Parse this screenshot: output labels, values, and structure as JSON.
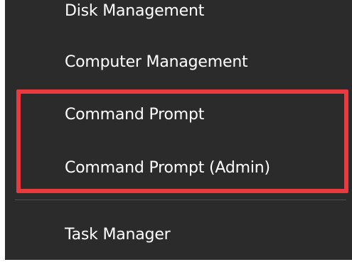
{
  "context_menu": {
    "items": [
      {
        "label": "Disk Management"
      },
      {
        "label": "Computer Management"
      },
      {
        "label": "Command Prompt"
      },
      {
        "label": "Command Prompt (Admin)"
      },
      {
        "label": "Task Manager"
      }
    ]
  },
  "colors": {
    "menu_background": "#2b2b2b",
    "menu_text": "#ffffff",
    "highlight_border": "#e83a3f"
  }
}
